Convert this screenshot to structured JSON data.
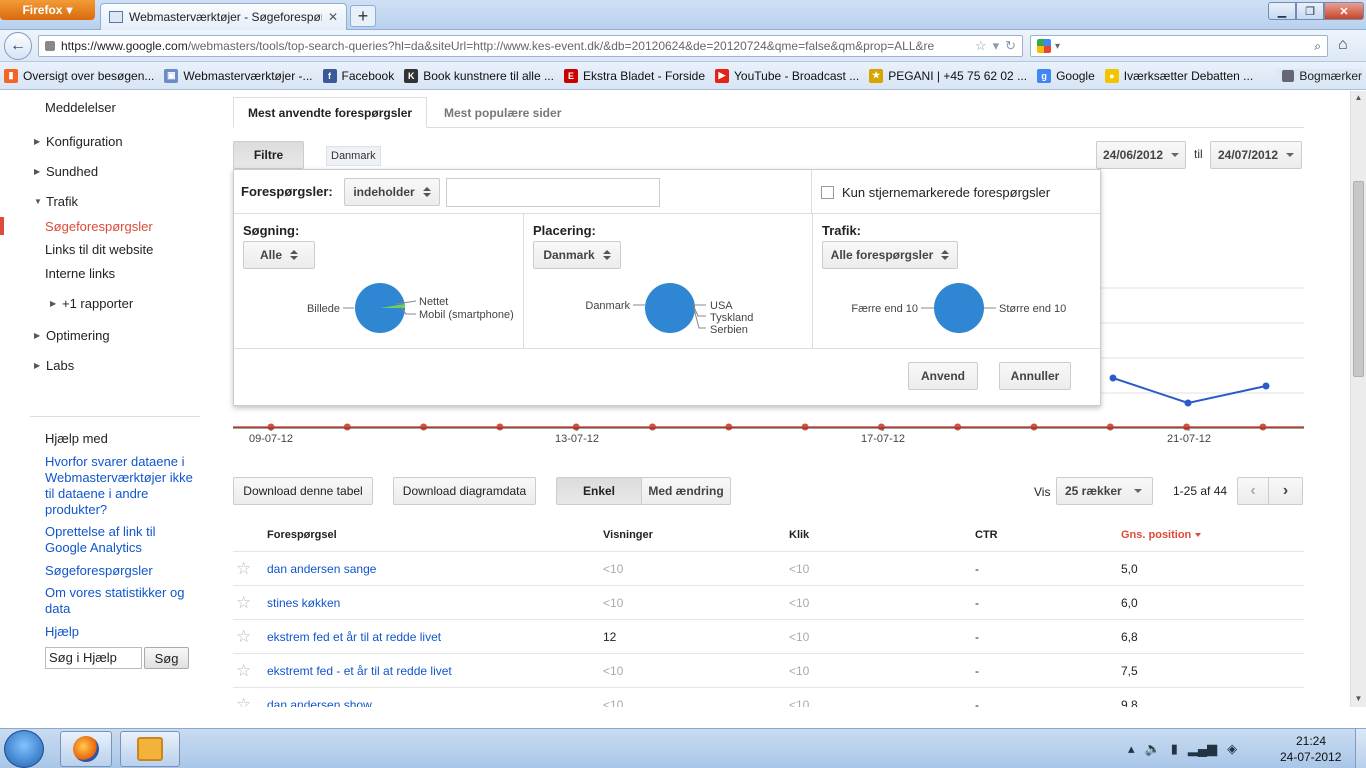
{
  "browser": {
    "menu_label": "Firefox",
    "tab_title": "Webmasterværktøjer - Søgeforespørgsle...",
    "new_tab": "+",
    "url_base": "https://www.google.com",
    "url_rest": "/webmasters/tools/top-search-queries?hl=da&siteUrl=http://www.kes-event.dk/&db=20120624&de=20120724&qme=false&qm&prop=ALL&re",
    "bookmarks": [
      {
        "label": "Oversigt over besøgen...",
        "color": "#f26522",
        "glyph": "▮"
      },
      {
        "label": "Webmasterværktøjer -...",
        "color": "#6b8cc4",
        "glyph": "▣"
      },
      {
        "label": "Facebook",
        "color": "#3b5998",
        "glyph": "f"
      },
      {
        "label": "Book kunstnere til alle ...",
        "color": "#333333",
        "glyph": "K"
      },
      {
        "label": "Ekstra Bladet - Forside",
        "color": "#cc0000",
        "glyph": "E"
      },
      {
        "label": "YouTube - Broadcast ...",
        "color": "#e62117",
        "glyph": "▶"
      },
      {
        "label": "PEGANI | +45 75 62 02 ...",
        "color": "#d9a400",
        "glyph": "★"
      },
      {
        "label": "Google",
        "color": "#4285f4",
        "glyph": "g"
      },
      {
        "label": "Iværksætter Debatten ...",
        "color": "#f5c400",
        "glyph": "●"
      }
    ],
    "bookmarks_menu": "Bogmærker"
  },
  "sidebar": {
    "top_item": "Meddelelser",
    "items": [
      {
        "label": "Konfiguration"
      },
      {
        "label": "Sundhed"
      },
      {
        "label": "Trafik"
      }
    ],
    "traffic_sub": [
      {
        "label": "Søgeforespørgsler"
      },
      {
        "label": "Links til dit website"
      },
      {
        "label": "Interne links"
      }
    ],
    "more_reports": "+1 rapporter",
    "items_after": [
      {
        "label": "Optimering"
      },
      {
        "label": "Labs"
      }
    ],
    "help_title": "Hjælp med",
    "help_links": [
      "Hvorfor svarer dataene i Webmasterværktøjer ikke til dataene i andre produkter?",
      "Oprettelse af link til Google Analytics",
      "Søgeforespørgsler",
      "Om vores statistikker og data",
      "Hjælp"
    ],
    "help_search_value": "Søg i Hjælp",
    "help_search_button": "Søg"
  },
  "main": {
    "tabs": [
      "Mest anvendte forespørgsler",
      "Mest populære sider"
    ],
    "filter_button": "Filtre",
    "filter_chip": "Danmark",
    "date_from": "24/06/2012",
    "date_to_label": "til",
    "date_to": "24/07/2012"
  },
  "filter_panel": {
    "query_label": "Forespørgsler:",
    "query_mode": "indeholder",
    "query_value": "",
    "starred_only": "Kun stjernemarkerede forespørgsler",
    "search": {
      "title": "Søgning:",
      "value": "Alle",
      "labels": [
        "Billede",
        "Nettet",
        "Mobil (smartphone)"
      ]
    },
    "location": {
      "title": "Placering:",
      "value": "Danmark",
      "labels": [
        "Danmark",
        "USA",
        "Tyskland",
        "Serbien"
      ]
    },
    "traffic": {
      "title": "Trafik:",
      "value": "Alle forespørgsler",
      "labels": [
        "Færre end 10",
        "Større end 10"
      ]
    },
    "apply": "Anvend",
    "cancel": "Annuller",
    "pie_color": "#2f86d2"
  },
  "chart_data": {
    "type": "line",
    "x_tick_labels": [
      "09-07-12",
      "13-07-12",
      "17-07-12",
      "21-07-12"
    ],
    "series": [
      {
        "color": "#2a5cc9",
        "values_visible": [
          {
            "x": "20-07-12",
            "y": 0.62
          },
          {
            "x": "21-07-12",
            "y": 0.95
          },
          {
            "x": "22-07-12",
            "y": 0.7
          }
        ]
      },
      {
        "color": "#dd4b39",
        "points_count": 14,
        "constant": true
      }
    ],
    "grid": true
  },
  "toolbar": {
    "download_table": "Download denne tabel",
    "download_chart": "Download diagramdata",
    "view_simple": "Enkel",
    "view_change": "Med ændring",
    "show_label": "Vis",
    "rows_option": "25 rækker",
    "page_range": "1-25 af 44",
    "prev": "‹",
    "next": "›"
  },
  "table": {
    "columns": [
      "Forespørgsel",
      "Visninger",
      "Klik",
      "CTR",
      "Gns. position"
    ],
    "rows": [
      {
        "query": "dan andersen sange",
        "views": "<10",
        "clicks": "<10",
        "ctr": "-",
        "pos": "5,0",
        "views_dim": true
      },
      {
        "query": "stines køkken",
        "views": "<10",
        "clicks": "<10",
        "ctr": "-",
        "pos": "6,0",
        "views_dim": true
      },
      {
        "query": "ekstrem fed et år til at redde livet",
        "views": "12",
        "clicks": "<10",
        "ctr": "-",
        "pos": "6,8",
        "views_dim": false
      },
      {
        "query": "ekstremt fed - et år til at redde livet",
        "views": "<10",
        "clicks": "<10",
        "ctr": "-",
        "pos": "7,5",
        "views_dim": true
      },
      {
        "query": "dan andersen show",
        "views": "<10",
        "clicks": "<10",
        "ctr": "-",
        "pos": "9,8",
        "views_dim": true
      }
    ]
  },
  "taskbar": {
    "time": "21:24",
    "date": "24-07-2012"
  }
}
